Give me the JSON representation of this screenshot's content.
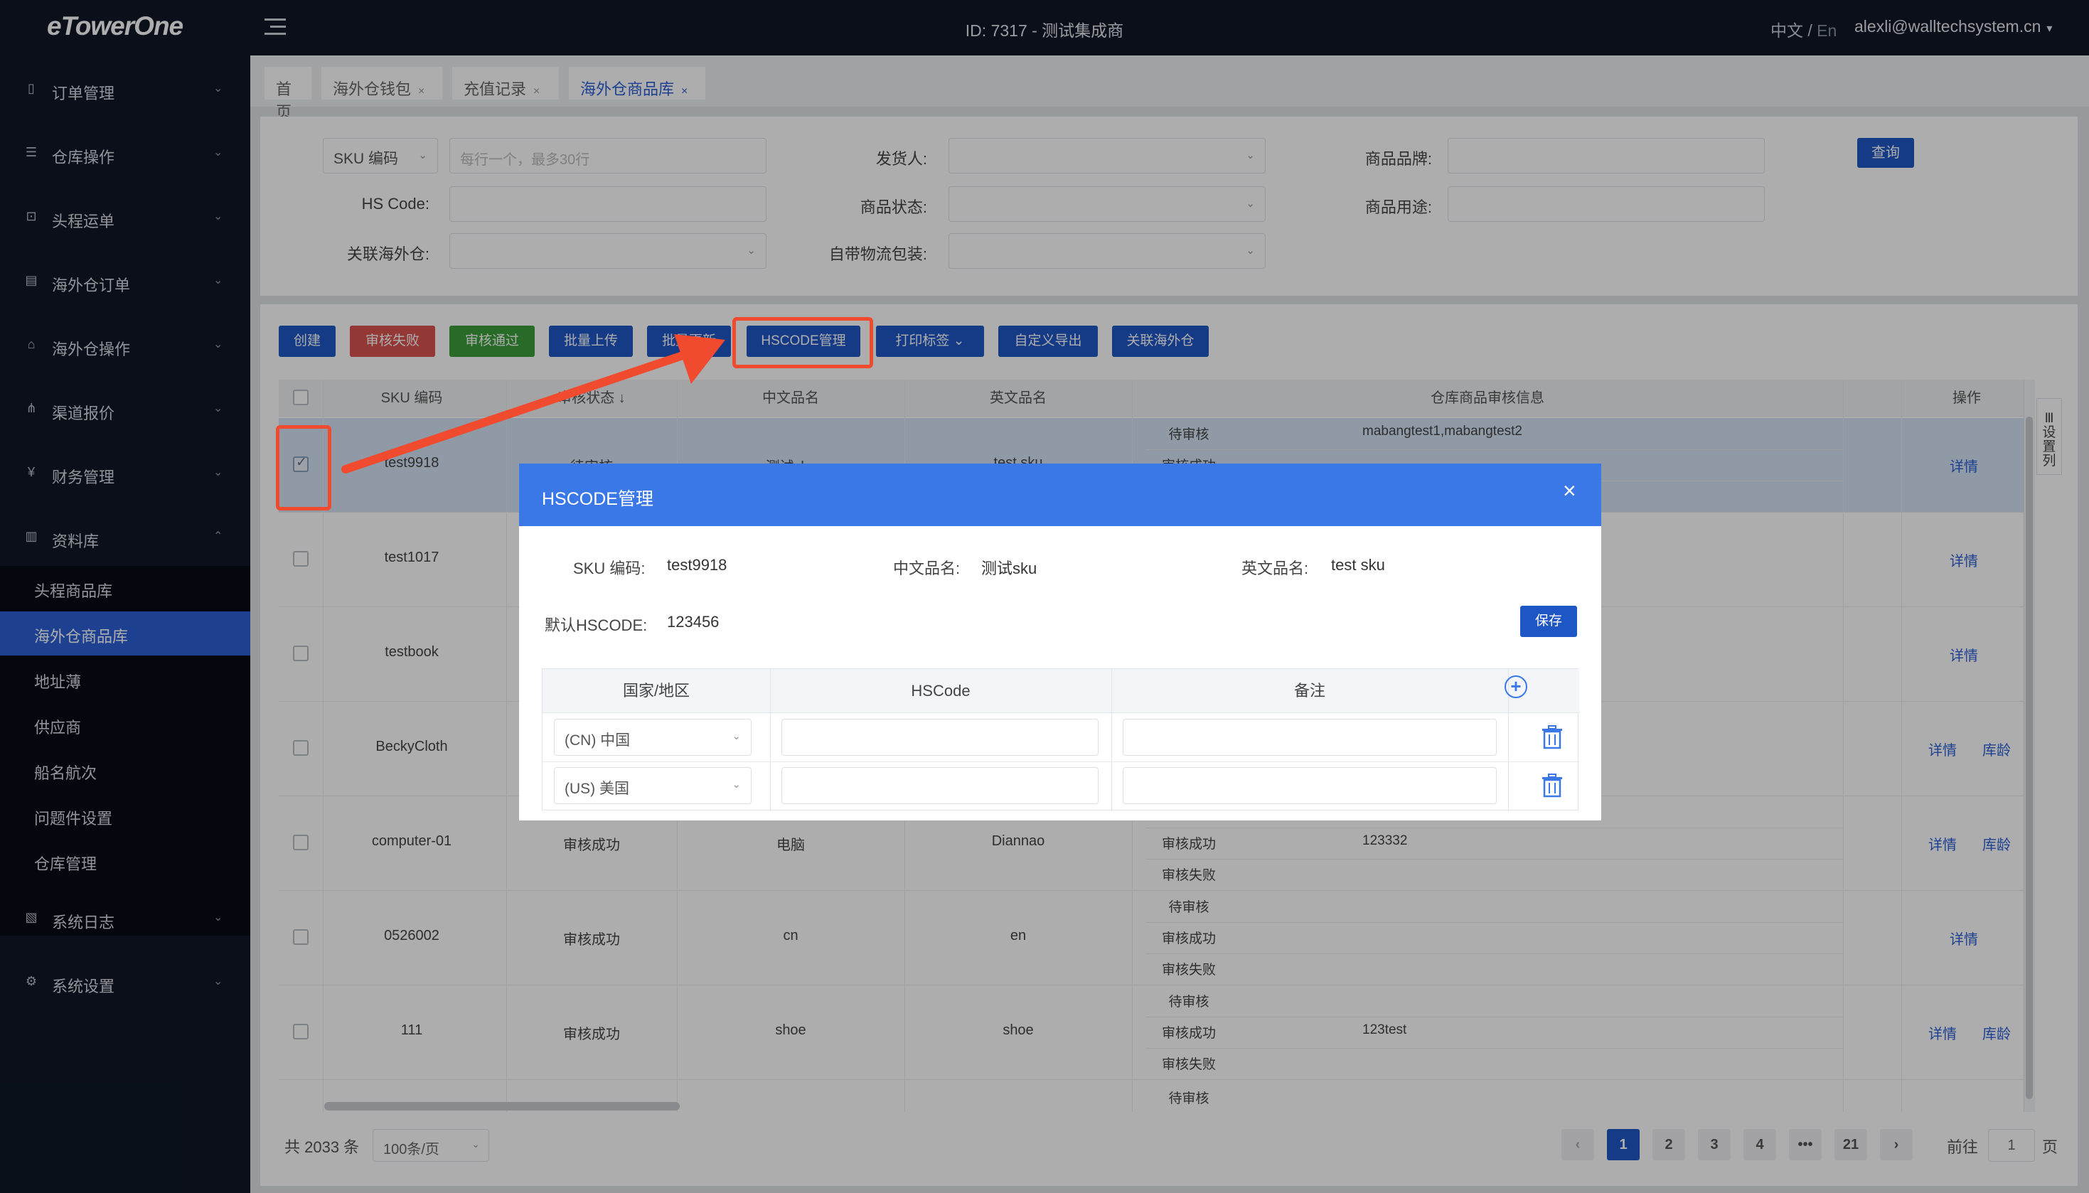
{
  "app": {
    "logo": "eTowerOne",
    "center_title": "ID: 7317 - 测试集成商",
    "lang_zh": "中文",
    "lang_sep": " / ",
    "lang_en": "En",
    "user_email": "alexli@walltechsystem.cn",
    "user_caret": "▾"
  },
  "sidebar": {
    "items": [
      {
        "label": "订单管理",
        "icon": "order-icon",
        "glyph": "▯",
        "chev": "⌄"
      },
      {
        "label": "仓库操作",
        "icon": "warehouse-icon",
        "glyph": "☰",
        "chev": "⌄"
      },
      {
        "label": "头程运单",
        "icon": "truck-icon",
        "glyph": "⊡",
        "chev": "⌄"
      },
      {
        "label": "海外仓订单",
        "icon": "overseas-order-icon",
        "glyph": "▤",
        "chev": "⌄"
      },
      {
        "label": "海外仓操作",
        "icon": "overseas-ops-icon",
        "glyph": "⌂",
        "chev": "⌄"
      },
      {
        "label": "渠道报价",
        "icon": "channel-icon",
        "glyph": "⋔",
        "chev": "⌄"
      },
      {
        "label": "财务管理",
        "icon": "yen-icon",
        "glyph": "¥",
        "chev": "⌄"
      },
      {
        "label": "资料库",
        "icon": "library-icon",
        "glyph": "▥",
        "chev": "⌃"
      },
      {
        "label": "系统日志",
        "icon": "log-icon",
        "glyph": "▧",
        "chev": "⌄"
      },
      {
        "label": "系统设置",
        "icon": "settings-icon",
        "glyph": "⚙",
        "chev": "⌄"
      }
    ],
    "subitems": [
      {
        "label": "头程商品库"
      },
      {
        "label": "海外仓商品库"
      },
      {
        "label": "地址薄"
      },
      {
        "label": "供应商"
      },
      {
        "label": "船名航次"
      },
      {
        "label": "问题件设置"
      },
      {
        "label": "仓库管理"
      }
    ]
  },
  "tabs": [
    {
      "label": "首页",
      "close": ""
    },
    {
      "label": "海外仓钱包",
      "close": "×"
    },
    {
      "label": "充值记录",
      "close": "×"
    },
    {
      "label": "海外仓商品库",
      "close": "×"
    }
  ],
  "filters": {
    "sku_type": "SKU 编码",
    "sku_placeholder": "每行一个，最多30行",
    "shipper_label": "发货人:",
    "brand_label": "商品品牌:",
    "query": "查询",
    "hscode_label": "HS Code:",
    "status_label": "商品状态:",
    "usage_label": "商品用途:",
    "linked_label": "关联海外仓:",
    "pack_label": "自带物流包装:",
    "arrow": "⌄"
  },
  "actions": [
    {
      "label": "创建",
      "color": "#1f56c6"
    },
    {
      "label": "审核失败",
      "color": "#d9534f"
    },
    {
      "label": "审核通过",
      "color": "#3b9e3b"
    },
    {
      "label": "批量上传",
      "color": "#1f56c6"
    },
    {
      "label": "批量更新",
      "color": "#1f56c6"
    },
    {
      "label": "HSCODE管理",
      "color": "#1f56c6"
    },
    {
      "label": "打印标签 ⌄",
      "color": "#1f56c6"
    },
    {
      "label": "自定义导出",
      "color": "#1f56c6"
    },
    {
      "label": "关联海外仓",
      "color": "#1f56c6"
    }
  ],
  "table": {
    "headers": {
      "sku": "SKU 编码",
      "review": "审核状态 ↓",
      "cn": "中文品名",
      "en": "英文品名",
      "info": "仓库商品审核信息",
      "ops": "操作"
    },
    "side_settings": "Ⅲ 设 置 列",
    "rows": [
      {
        "sku": "test9918",
        "status": "待审核",
        "cn": "测试sku",
        "en": "test sku",
        "sub": [
          {
            "s": "待审核",
            "v": "mabangtest1,mabangtest2"
          },
          {
            "s": "审核成功",
            "v": ""
          },
          {
            "s": "",
            "v": ""
          }
        ],
        "ops": [
          "详情"
        ]
      },
      {
        "sku": "test1017",
        "status": "",
        "cn": "",
        "en": "",
        "sub": [],
        "ops": [
          "详情"
        ]
      },
      {
        "sku": "testbook",
        "status": "",
        "cn": "",
        "en": "",
        "sub": [],
        "ops": [
          "详情"
        ]
      },
      {
        "sku": "BeckyCloth",
        "status": "",
        "cn": "",
        "en": "",
        "sub": [],
        "ops": [
          "详情",
          "库龄"
        ]
      },
      {
        "sku": "computer-01",
        "status": "审核成功",
        "cn": "电脑",
        "en": "Diannao",
        "sub": [
          {
            "s": "",
            "v": ""
          },
          {
            "s": "审核成功",
            "v": "123332"
          },
          {
            "s": "审核失败",
            "v": ""
          }
        ],
        "ops": [
          "详情",
          "库龄"
        ]
      },
      {
        "sku": "0526002",
        "status": "审核成功",
        "cn": "cn",
        "en": "en",
        "sub": [
          {
            "s": "待审核",
            "v": ""
          },
          {
            "s": "审核成功",
            "v": ""
          },
          {
            "s": "审核失败",
            "v": ""
          }
        ],
        "ops": [
          "详情"
        ]
      },
      {
        "sku": "111",
        "status": "审核成功",
        "cn": "shoe",
        "en": "shoe",
        "sub": [
          {
            "s": "待审核",
            "v": ""
          },
          {
            "s": "审核成功",
            "v": "123test"
          },
          {
            "s": "审核失败",
            "v": ""
          }
        ],
        "ops": [
          "详情",
          "库龄"
        ]
      }
    ],
    "partial_row_status": "待审核"
  },
  "pager": {
    "total": "共 2033 条",
    "page_size": "100条/页",
    "prev": "‹",
    "pages": [
      "1",
      "2",
      "3",
      "4",
      "•••",
      "21"
    ],
    "next": "›",
    "goto_label": "前往",
    "goto_value": "1",
    "goto_suffix": "页"
  },
  "modal": {
    "title": "HSCODE管理",
    "close": "×",
    "sku_label": "SKU 编码:",
    "sku_value": "test9918",
    "cn_label": "中文品名:",
    "cn_value": "测试sku",
    "en_label": "英文品名:",
    "en_value": "test sku",
    "default_label": "默认HSCODE:",
    "default_value": "123456",
    "save": "保存",
    "headers": {
      "country": "国家/地区",
      "hscode": "HSCode",
      "remark": "备注",
      "add": "+"
    },
    "rows": [
      {
        "country": "(CN) 中国",
        "hscode": "",
        "remark": ""
      },
      {
        "country": "(US) 美国",
        "hscode": "",
        "remark": ""
      }
    ]
  },
  "colors": {
    "accent": "#1f56c6",
    "modal_header": "#3a78e8",
    "annotation": "#f04b2f",
    "sidebar_bg": "#0f1727"
  }
}
